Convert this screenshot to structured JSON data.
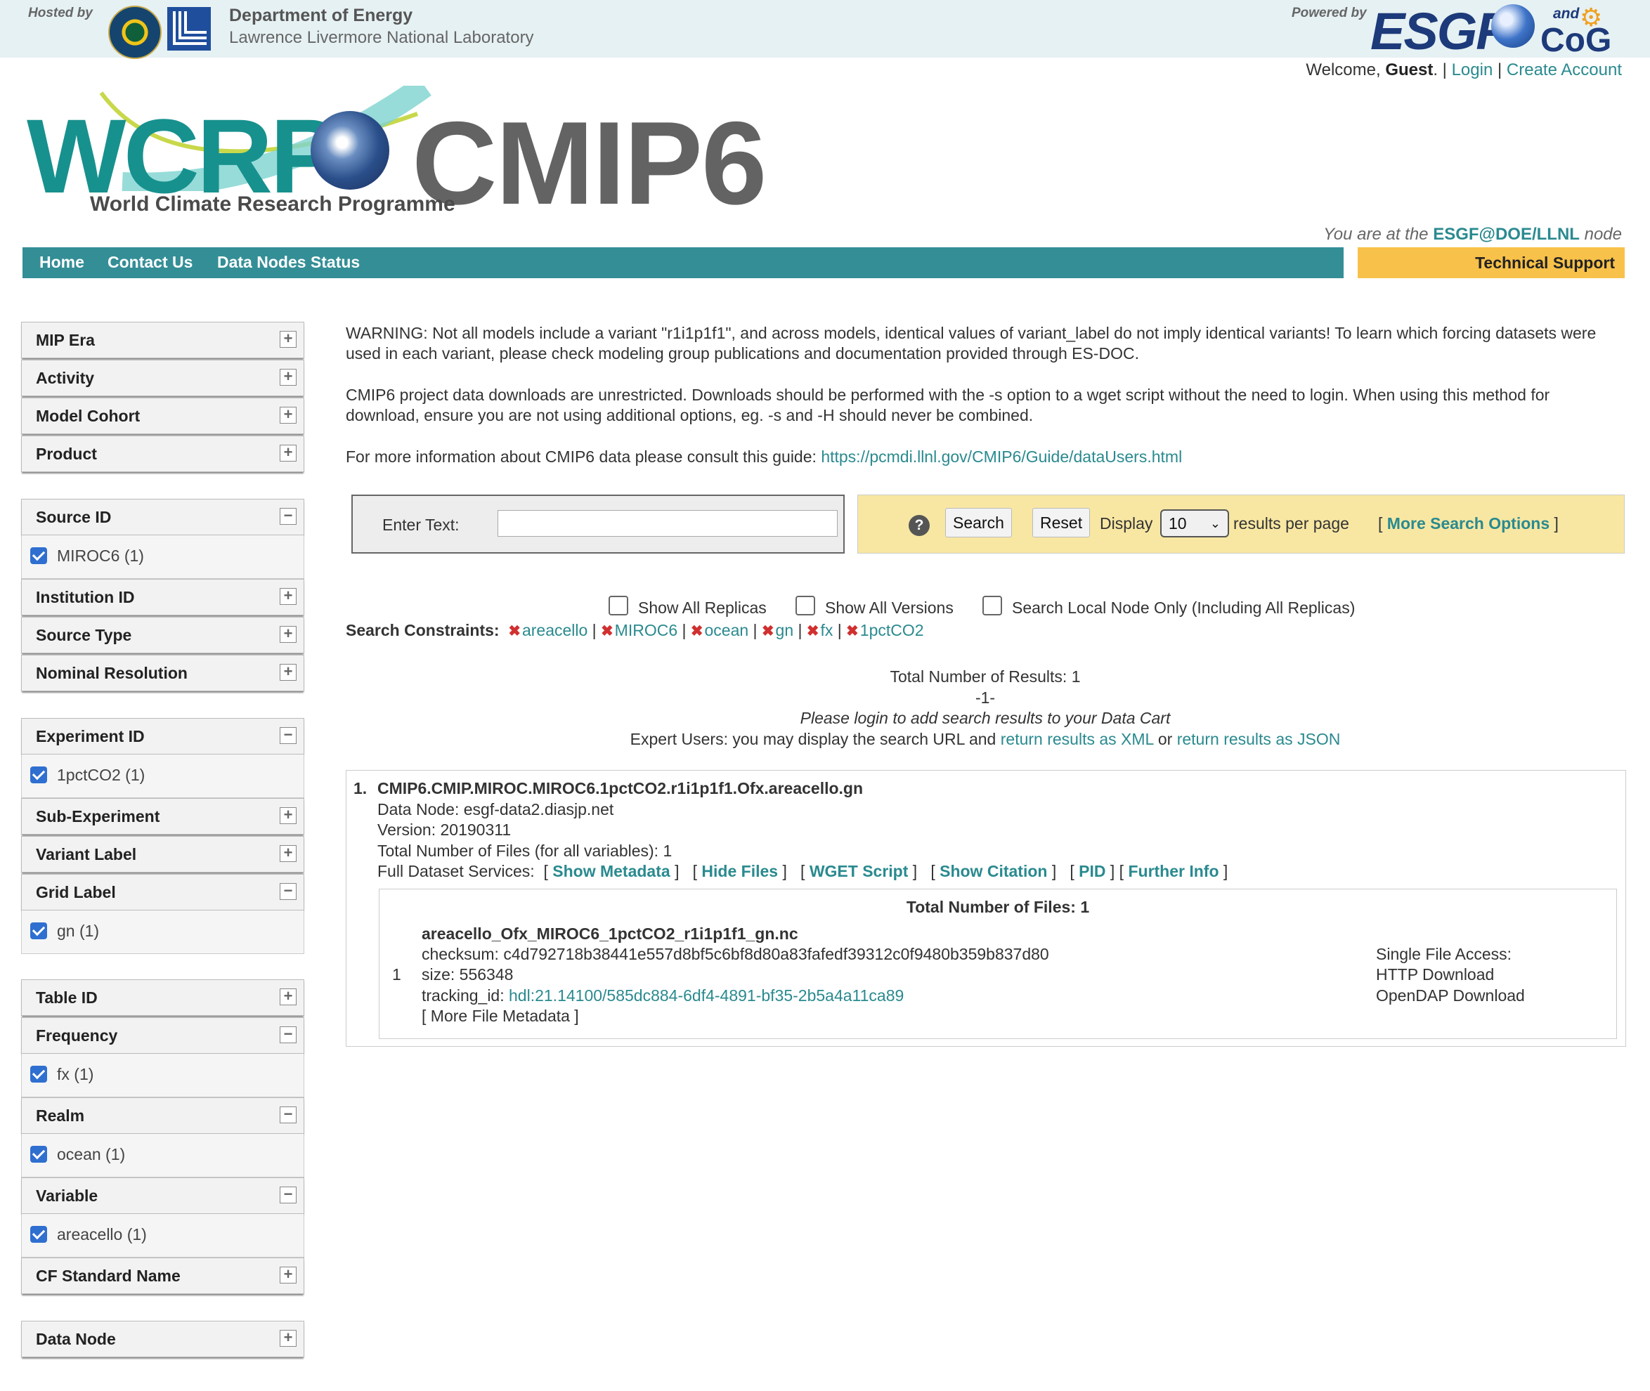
{
  "header": {
    "hosted_by": "Hosted by",
    "doe": "Department of Energy",
    "llnl": "Lawrence Livermore National Laboratory",
    "powered_by": "Powered by",
    "esgf": "ESGF",
    "and": "and",
    "cog": "CoG"
  },
  "account": {
    "welcome_prefix": "Welcome, ",
    "user": "Guest",
    "welcome_suffix": ". |",
    "login": "Login",
    "sep": "|",
    "create": "Create Account"
  },
  "logo": {
    "wcrp": "WCRP",
    "cmip6": "CMIP6",
    "subtitle": "World Climate Research Programme"
  },
  "node": {
    "prefix": "You are at the ",
    "name": "ESGF@DOE/LLNL",
    "suffix": " node"
  },
  "nav": {
    "home": "Home",
    "contact": "Contact Us",
    "status": "Data Nodes Status",
    "support": "Technical Support"
  },
  "facets": {
    "mip_era": "MIP Era",
    "activity": "Activity",
    "model_cohort": "Model Cohort",
    "product": "Product",
    "source_id": "Source ID",
    "source_id_value": "MIROC6 (1)",
    "institution_id": "Institution ID",
    "source_type": "Source Type",
    "nominal_resolution": "Nominal Resolution",
    "experiment_id": "Experiment ID",
    "experiment_id_value": "1pctCO2 (1)",
    "sub_experiment": "Sub-Experiment",
    "variant_label": "Variant Label",
    "grid_label": "Grid Label",
    "grid_label_value": "gn (1)",
    "table_id": "Table ID",
    "frequency": "Frequency",
    "frequency_value": "fx (1)",
    "realm": "Realm",
    "realm_value": "ocean (1)",
    "variable": "Variable",
    "variable_value": "areacello (1)",
    "cf_standard_name": "CF Standard Name",
    "data_node": "Data Node",
    "plus": "+",
    "minus": "−"
  },
  "notices": {
    "warning": "WARNING: Not all models include a variant \"r1i1p1f1\", and across models, identical values of variant_label do not imply identical variants! To learn which forcing datasets were used in each variant, please check modeling group publications and documentation provided through ES-DOC.",
    "downloads": "CMIP6 project data downloads are unrestricted. Downloads should be performed with the -s option to a wget script without the need to login. When using this method for download, ensure you are not using additional options, eg. -s and -H should never be combined.",
    "guide_prefix": "For more information about CMIP6 data please consult this guide: ",
    "guide_link": "https://pcmdi.llnl.gov/CMIP6/Guide/dataUsers.html"
  },
  "search": {
    "enter_text": "Enter Text:",
    "query": "",
    "help": "?",
    "search_btn": "Search",
    "reset_btn": "Reset",
    "display": "Display",
    "per_page": "10",
    "results_per_page": "results per page",
    "more_open": "[",
    "more_options": "More Search Options",
    "more_close": "]"
  },
  "toggles": {
    "replicas": "Show All Replicas",
    "versions": "Show All Versions",
    "local": "Search Local Node Only (Including All Replicas)"
  },
  "constraints": {
    "label": "Search Constraints:",
    "items": [
      "areacello",
      "MIROC6",
      "ocean",
      "gn",
      "fx",
      "1pctCO2"
    ]
  },
  "results_info": {
    "total": "Total Number of Results: 1",
    "page": "-1-",
    "login_note": "Please login to add search results to your Data Cart",
    "expert_prefix": "Expert Users: you may display the search URL and ",
    "xml": "return results as XML",
    "or": " or ",
    "json": "return results as JSON"
  },
  "result": {
    "index": "1.",
    "title": "CMIP6.CMIP.MIROC.MIROC6.1pctCO2.r1i1p1f1.Ofx.areacello.gn",
    "data_node": "Data Node: esgf-data2.diasjp.net",
    "version": "Version: 20190311",
    "total_files": "Total Number of Files (for all variables): 1",
    "services_label": "Full Dataset Services:",
    "services": [
      "Show Metadata",
      "Hide Files",
      "WGET Script",
      "Show Citation",
      "PID",
      "Further Info"
    ],
    "files": {
      "header": "Total Number of Files: 1",
      "index": "1",
      "filename": "areacello_Ofx_MIROC6_1pctCO2_r1i1p1f1_gn.nc",
      "checksum": "checksum: c4d792718b38441e557d8bf5c6bf8d80a83fafedf39312c0f9480b359b837d80",
      "size": "size: 556348",
      "tracking_label": "tracking_id: ",
      "tracking_id": "hdl:21.14100/585dc884-6df4-4891-bf35-2b5a4a11ca89",
      "more_metadata": "[ More File Metadata ]",
      "access_label": "Single File Access:",
      "http": "HTTP Download",
      "opendap": "OpenDAP Download"
    }
  }
}
